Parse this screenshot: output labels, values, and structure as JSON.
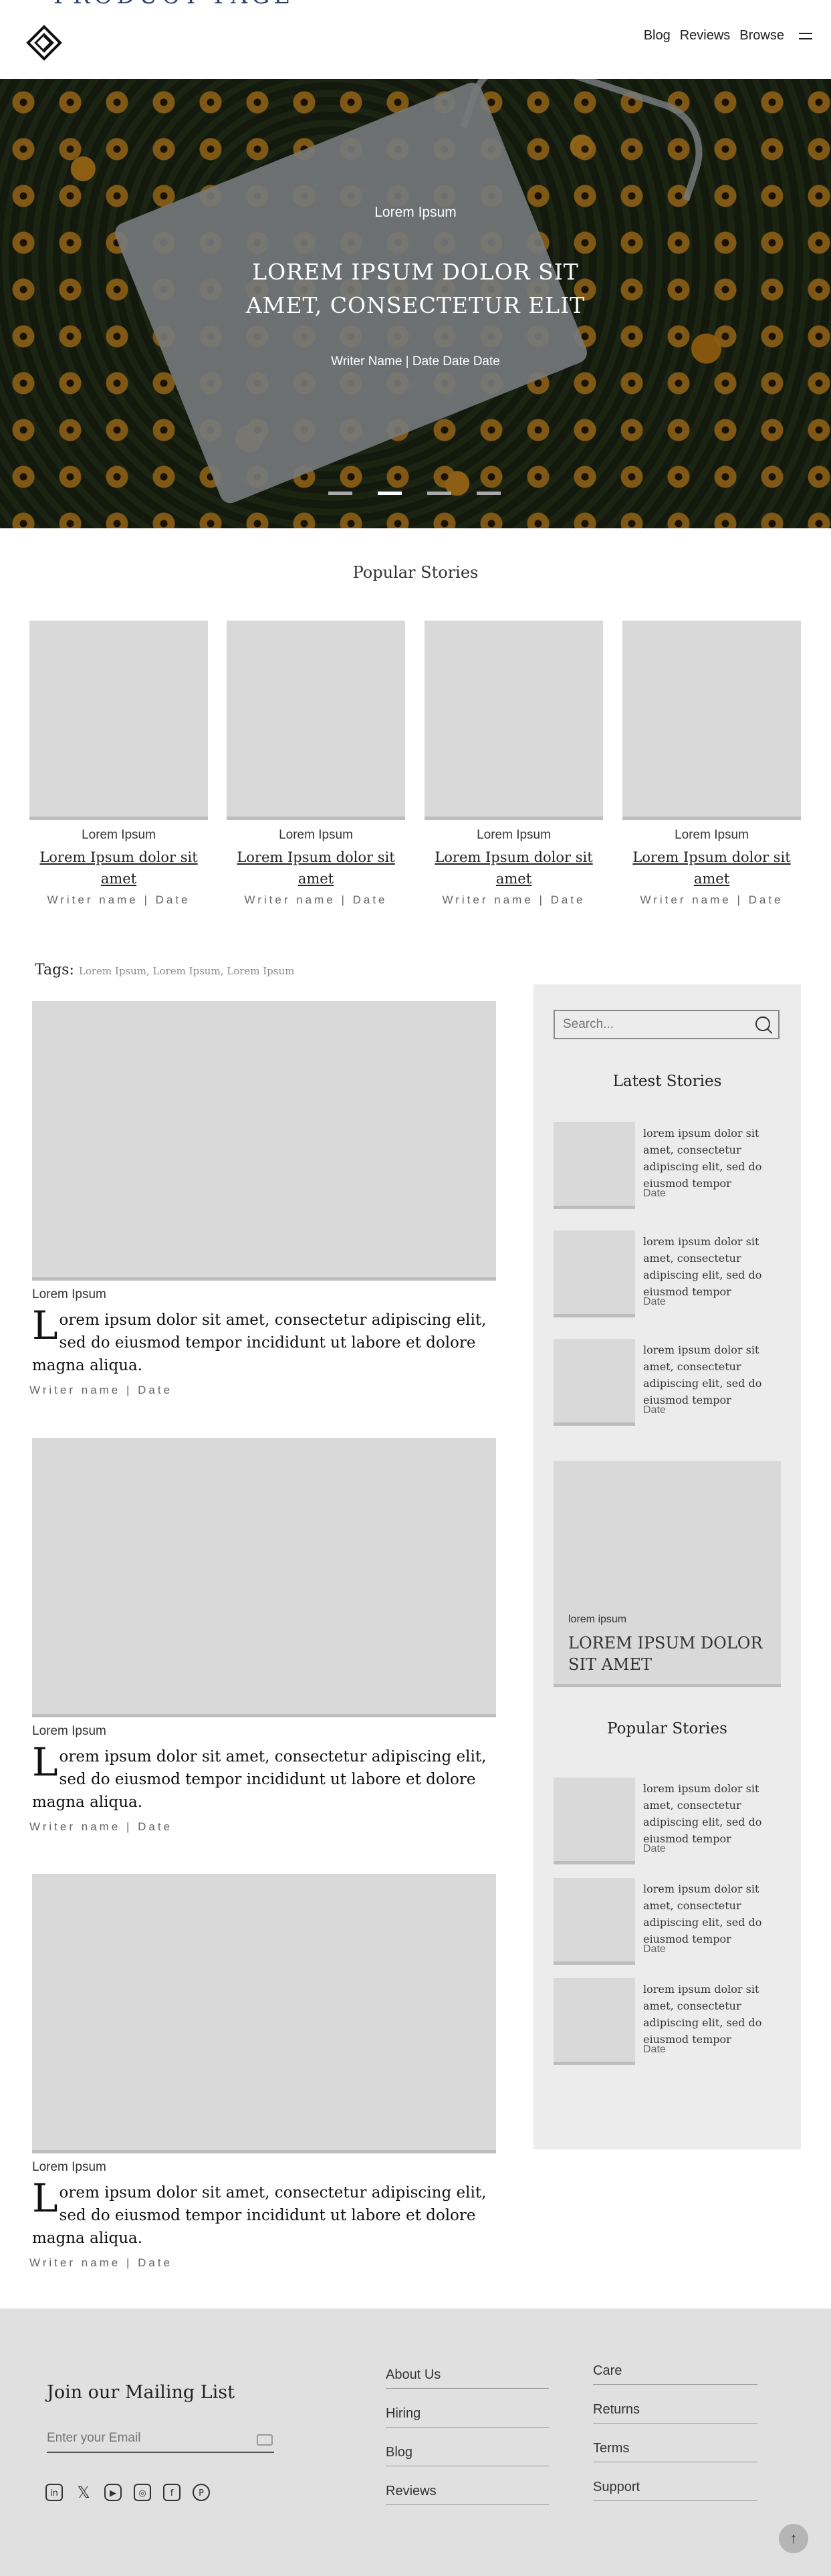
{
  "header": {
    "brand_partial": "PRODUCT PAGE",
    "nav": [
      "Blog",
      "Reviews",
      "Browse"
    ]
  },
  "hero": {
    "kicker": "Lorem Ipsum",
    "title": "LOREM IPSUM DOLOR SIT AMET, CONSECTETUR ELIT",
    "meta": "Writer Name | Date Date Date",
    "slides": 4,
    "active_slide": 2
  },
  "popular": {
    "title": "Popular Stories",
    "cards": [
      {
        "category": "Lorem Ipsum",
        "title": "Lorem Ipsum dolor sit amet",
        "meta": "Writer name | Date"
      },
      {
        "category": "Lorem Ipsum",
        "title": "Lorem Ipsum dolor sit amet",
        "meta": "Writer name | Date"
      },
      {
        "category": "Lorem Ipsum",
        "title": "Lorem Ipsum dolor sit amet",
        "meta": "Writer name | Date"
      },
      {
        "category": "Lorem Ipsum",
        "title": "Lorem Ipsum dolor sit amet",
        "meta": "Writer name | Date"
      }
    ]
  },
  "tags": {
    "label": "Tags:",
    "items": "Lorem Ipsum, Lorem Ipsum, Lorem Ipsum"
  },
  "articles": [
    {
      "category": "Lorem Ipsum",
      "dropcap": "L",
      "text": "orem ipsum dolor sit amet, consectetur adipiscing elit, sed do eiusmod tempor incididunt ut labore et dolore magna aliqua.",
      "meta": "Writer name | Date"
    },
    {
      "category": "Lorem Ipsum",
      "dropcap": "L",
      "text": "orem ipsum dolor sit amet, consectetur adipiscing elit, sed do eiusmod tempor incididunt ut labore et dolore magna aliqua.",
      "meta": "Writer name | Date"
    },
    {
      "category": "Lorem Ipsum",
      "dropcap": "L",
      "text": "orem ipsum dolor sit amet, consectetur adipiscing elit, sed do eiusmod tempor incididunt ut labore et dolore magna aliqua.",
      "meta": "Writer name | Date"
    }
  ],
  "sidebar": {
    "search_placeholder": "Search...",
    "latest_title": "Latest Stories",
    "latest": [
      {
        "text": "lorem ipsum dolor sit amet, consectetur adipiscing elit, sed do eiusmod tempor",
        "date": "Date"
      },
      {
        "text": "lorem ipsum dolor sit amet, consectetur adipiscing elit, sed do eiusmod tempor",
        "date": "Date"
      },
      {
        "text": "lorem ipsum dolor sit amet, consectetur adipiscing elit, sed do eiusmod tempor",
        "date": "Date"
      }
    ],
    "feature": {
      "kicker": "lorem ipsum",
      "title": "LOREM IPSUM DOLOR SIT AMET"
    },
    "popular_title": "Popular Stories",
    "popular": [
      {
        "text": "lorem ipsum dolor sit amet, consectetur adipiscing elit, sed do eiusmod tempor",
        "date": "Date"
      },
      {
        "text": "lorem ipsum dolor sit amet, consectetur adipiscing elit, sed do eiusmod tempor",
        "date": "Date"
      },
      {
        "text": "lorem ipsum dolor sit amet, consectetur adipiscing elit, sed do eiusmod tempor",
        "date": "Date"
      }
    ]
  },
  "footer": {
    "mailing_title": "Join our Mailing List",
    "email_placeholder": "Enter your Email",
    "socials": [
      "linkedin-icon",
      "x-icon",
      "youtube-icon",
      "instagram-icon",
      "facebook-icon",
      "pinterest-icon"
    ],
    "col1": [
      "About Us",
      "Hiring",
      "Blog",
      "Reviews"
    ],
    "col2": [
      "Care",
      "Returns",
      "Terms",
      "Support"
    ],
    "top_icon": "↑"
  }
}
